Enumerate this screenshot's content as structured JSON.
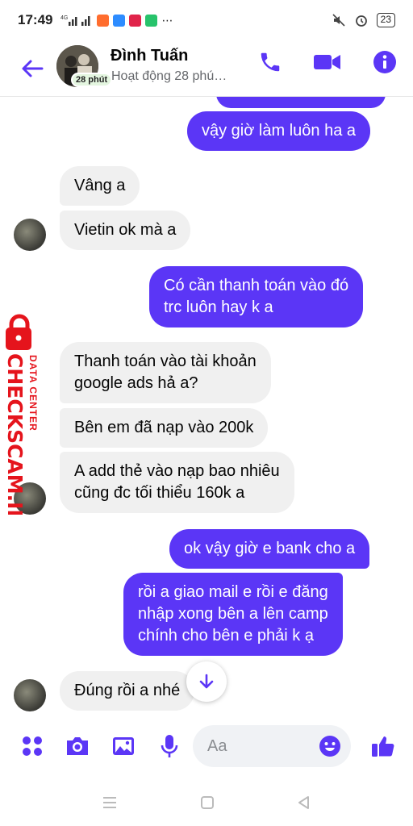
{
  "status_bar": {
    "time": "17:49",
    "network": "4G",
    "battery": "23"
  },
  "header": {
    "name": "Đình Tuấn",
    "status": "Hoạt động 28 phú…",
    "active_badge": "28 phút",
    "accent_color": "#5b36f6"
  },
  "messages": [
    {
      "side": "out",
      "text": "vậy giờ làm luôn ha a"
    },
    {
      "side": "in",
      "text": "Vâng a"
    },
    {
      "side": "in",
      "text": "Vietin ok mà a"
    },
    {
      "side": "out",
      "text_lines": [
        "Có cần thanh toán vào đó",
        "trc luôn hay k a"
      ]
    },
    {
      "side": "in",
      "text_lines": [
        "Thanh toán vào tài khoản",
        "google ads hả a?"
      ]
    },
    {
      "side": "in",
      "text": "Bên em đã nạp vào 200k"
    },
    {
      "side": "in",
      "text_lines": [
        "A add thẻ vào nạp bao nhiêu",
        "cũng đc tối thiểu 160k a"
      ]
    },
    {
      "side": "out",
      "text": "ok vậy giờ e bank cho a"
    },
    {
      "side": "out",
      "text_lines": [
        "rồi a giao mail e rồi e đăng",
        "nhập xong bên a lên camp",
        "chính cho bên e phải k ạ"
      ]
    },
    {
      "side": "in",
      "text": "Đúng rồi a nhé"
    }
  ],
  "watermark": {
    "brand": "CHECKSCAM.INFO",
    "sub": "DATA CENTER"
  },
  "composer": {
    "placeholder": "Aa"
  }
}
